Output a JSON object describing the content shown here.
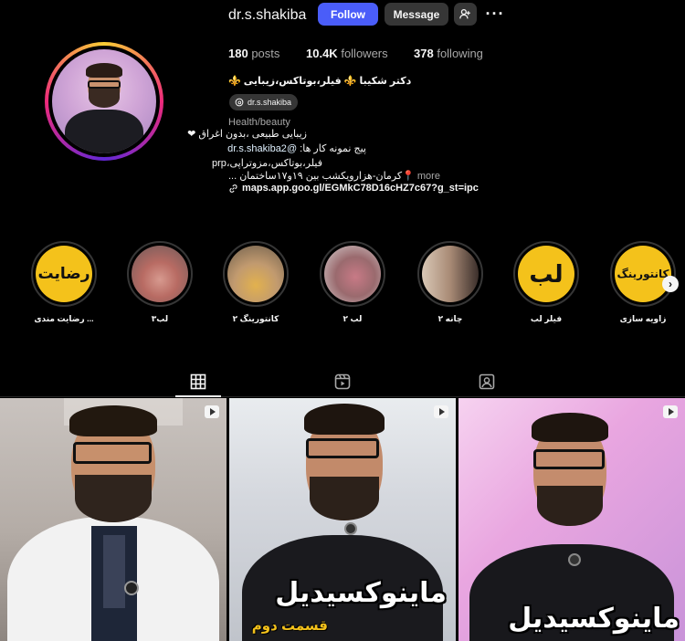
{
  "profile": {
    "username": "dr.s.shakiba",
    "follow_label": "Follow",
    "message_label": "Message",
    "posts_count": "180",
    "posts_label": "posts",
    "followers_count": "10.4K",
    "followers_label": "followers",
    "following_count": "378",
    "following_label": "following",
    "full_name": "⚜️ دکتر شکیبا ⚜️ فیلر،بوتاکس،زیبایی",
    "threads_handle": "dr.s.shakiba",
    "category": "Health/beauty",
    "bio_line1": "زیبایی طبیعی ،بدون اغراق ❤",
    "bio_line2_prefix": "پیج نمونه کار ها: ",
    "bio_line2_mention": "@dr.s.shakiba2",
    "bio_line3": "فیلر،بوتاکس،مزوتراپی،prp",
    "bio_line4": "📍کرمان-هزارویکشب بین ۱۹و۱۷ساختمان ...",
    "more_label": "more",
    "link": "maps.app.goo.gl/EGMkC78D16cHZ7c67?g_st=ipc"
  },
  "highlights": [
    {
      "label": "... رضایت مندی",
      "cover_text": "رضایت"
    },
    {
      "label": "لب۳",
      "cover_text": ""
    },
    {
      "label": "کانتورینگ ۲",
      "cover_text": ""
    },
    {
      "label": "لب ۲",
      "cover_text": ""
    },
    {
      "label": "چانه ۲",
      "cover_text": ""
    },
    {
      "label": "فیلر لب",
      "cover_text": "لب"
    },
    {
      "label": "زاویه سازی",
      "cover_text": "کانتورینگ"
    }
  ],
  "posts": [
    {
      "title": "",
      "subtitle": ""
    },
    {
      "title": "ماینوکسیدیل",
      "subtitle": "قسمت دوم"
    },
    {
      "title": "ماینوکسیدیل",
      "subtitle": ""
    }
  ],
  "colors": {
    "accent": "#4a5df9",
    "highlight_yellow": "#f4c21b"
  }
}
